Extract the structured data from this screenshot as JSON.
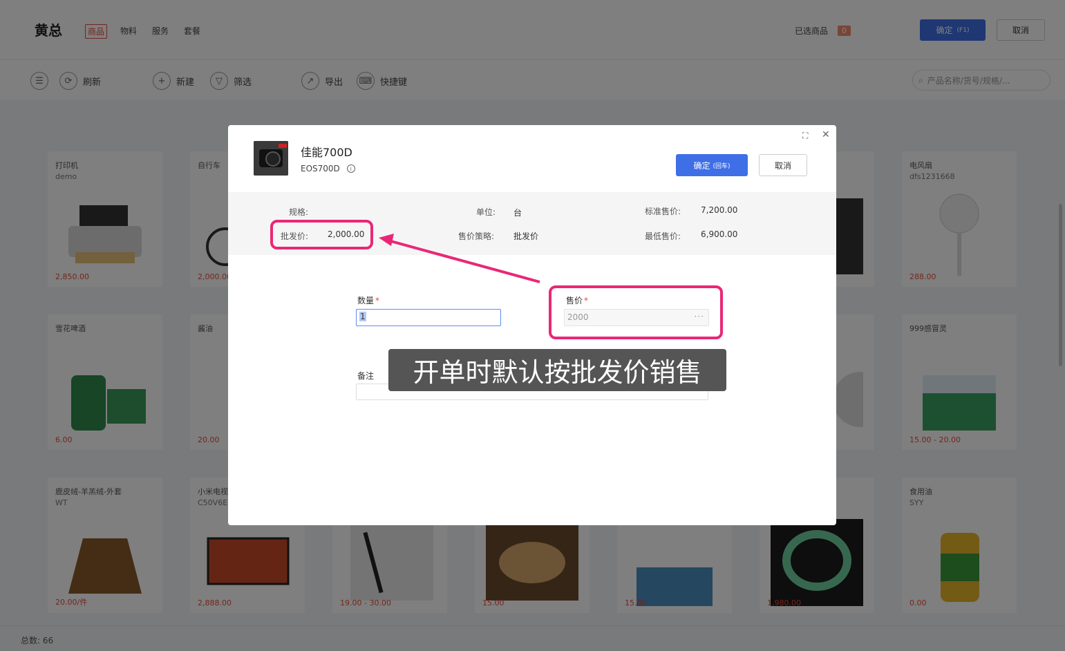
{
  "header": {
    "brand": "黄总",
    "tabs": [
      "商品",
      "物料",
      "服务",
      "套餐"
    ],
    "selected_label": "已选商品",
    "selected_count": "0",
    "confirm_label": "确定",
    "confirm_shortcut": "(F1)",
    "cancel_label": "取消"
  },
  "toolbar": {
    "refresh": "刷新",
    "new": "新建",
    "filter": "筛选",
    "export": "导出",
    "shortcuts": "快捷键",
    "search_placeholder": "产品名称/货号/规格/..."
  },
  "products": [
    {
      "name": "打印机",
      "sku": "demo",
      "price": "2,850.00"
    },
    {
      "name": "自行车",
      "sku": "",
      "price": "2,000.00"
    },
    {
      "name": "电风扇",
      "sku": "dfs1231668",
      "price": "288.00"
    },
    {
      "name": "雪花啤酒",
      "sku": "",
      "price": "6.00"
    },
    {
      "name": "酱油",
      "sku": "",
      "price": "20.00"
    },
    {
      "name": "999感冒灵",
      "sku": "",
      "price": "15.00 - 20.00"
    },
    {
      "name": "鹿皮绒-羊羔绒-外套",
      "sku": "WT",
      "price": "20.00/件"
    },
    {
      "name": "小米电视",
      "sku": "C50V6E",
      "price": "2,888.00"
    },
    {
      "name": "",
      "sku": "",
      "price": "19.00 - 30.00"
    },
    {
      "name": "",
      "sku": "",
      "price": "15.00"
    },
    {
      "name": "",
      "sku": "",
      "price": "15.00"
    },
    {
      "name": "",
      "sku": "",
      "price": "1,980.00"
    },
    {
      "name": "食用油",
      "sku": "SYY",
      "price": "0.00"
    }
  ],
  "product_icons": [
    "printer-image",
    "bicycle-image",
    "fan-image",
    "beer-image",
    "soy-sauce-image",
    "medicine-image",
    "jacket-image",
    "tv-image",
    "pen-image",
    "bread-image",
    "fertilizer-image",
    "jade-image",
    "oil-image"
  ],
  "footer": {
    "total_label": "总数:",
    "total_value": "66"
  },
  "modal": {
    "title": "佳能700D",
    "code": "EOS700D",
    "confirm_label": "确定",
    "confirm_hint": "(回车)",
    "cancel_label": "取消",
    "fields": {
      "spec_label": "规格:",
      "spec_value": "",
      "unit_label": "单位:",
      "unit_value": "台",
      "std_price_label": "标准售价:",
      "std_price_value": "7,200.00",
      "wholesale_label": "批发价:",
      "wholesale_value": "2,000.00",
      "strategy_label": "售价策略:",
      "strategy_value": "批发价",
      "min_price_label": "最低售价:",
      "min_price_value": "6,900.00"
    },
    "form": {
      "qty_label": "数量",
      "qty_value": "1",
      "price_label": "售价",
      "price_value": "2000",
      "remark_label": "备注"
    }
  },
  "annotation": {
    "caption": "开单时默认按批发价销售",
    "highlight_color": "#ea2776"
  },
  "colors": {
    "primary": "#3f6fe6",
    "accent_red": "#e84b3a"
  }
}
